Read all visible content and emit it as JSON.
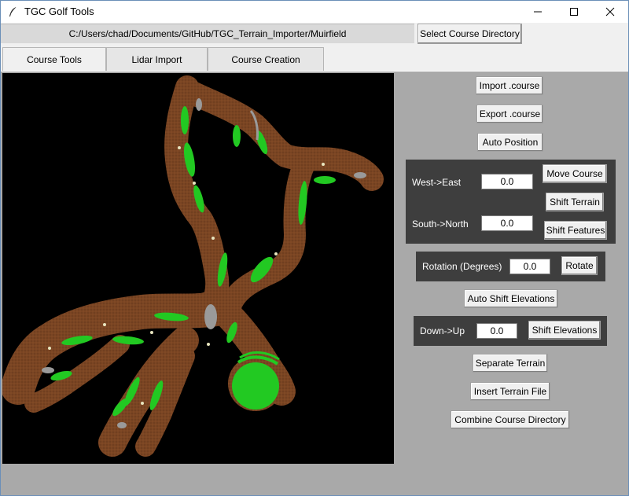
{
  "window": {
    "title": "TGC Golf Tools",
    "controls": {
      "minimize": "minimize-icon",
      "maximize": "maximize-icon",
      "close": "close-icon"
    }
  },
  "path_bar": {
    "path": "C:/Users/chad/Documents/GitHub/TGC_Terrain_Importer/Muirfield",
    "select_button": "Select Course Directory"
  },
  "tabs": [
    {
      "label": "Course Tools",
      "selected": true
    },
    {
      "label": "Lidar Import",
      "selected": false
    },
    {
      "label": "Course Creation",
      "selected": false
    }
  ],
  "tools": {
    "import_course": "Import .course",
    "export_course": "Export .course",
    "auto_position": "Auto Position",
    "west_east_label": "West->East",
    "west_east_value": "0.0",
    "south_north_label": "South->North",
    "south_north_value": "0.0",
    "move_course": "Move Course",
    "shift_terrain": "Shift Terrain",
    "shift_features": "Shift Features",
    "rotation_label": "Rotation (Degrees)",
    "rotation_value": "0.0",
    "rotate": "Rotate",
    "auto_shift_elevations": "Auto Shift Elevations",
    "down_up_label": "Down->Up",
    "down_up_value": "0.0",
    "shift_elevations": "Shift Elevations",
    "separate_terrain": "Separate Terrain",
    "insert_terrain_file": "Insert Terrain File",
    "combine_course_directory": "Combine Course Directory"
  },
  "colors": {
    "terrain": "#7a4523",
    "fairway": "#22c922",
    "water": "#9a9a9a",
    "sand": "#e8e6c0",
    "panel": "#3e3e3e",
    "background": "#a9a9a9"
  }
}
